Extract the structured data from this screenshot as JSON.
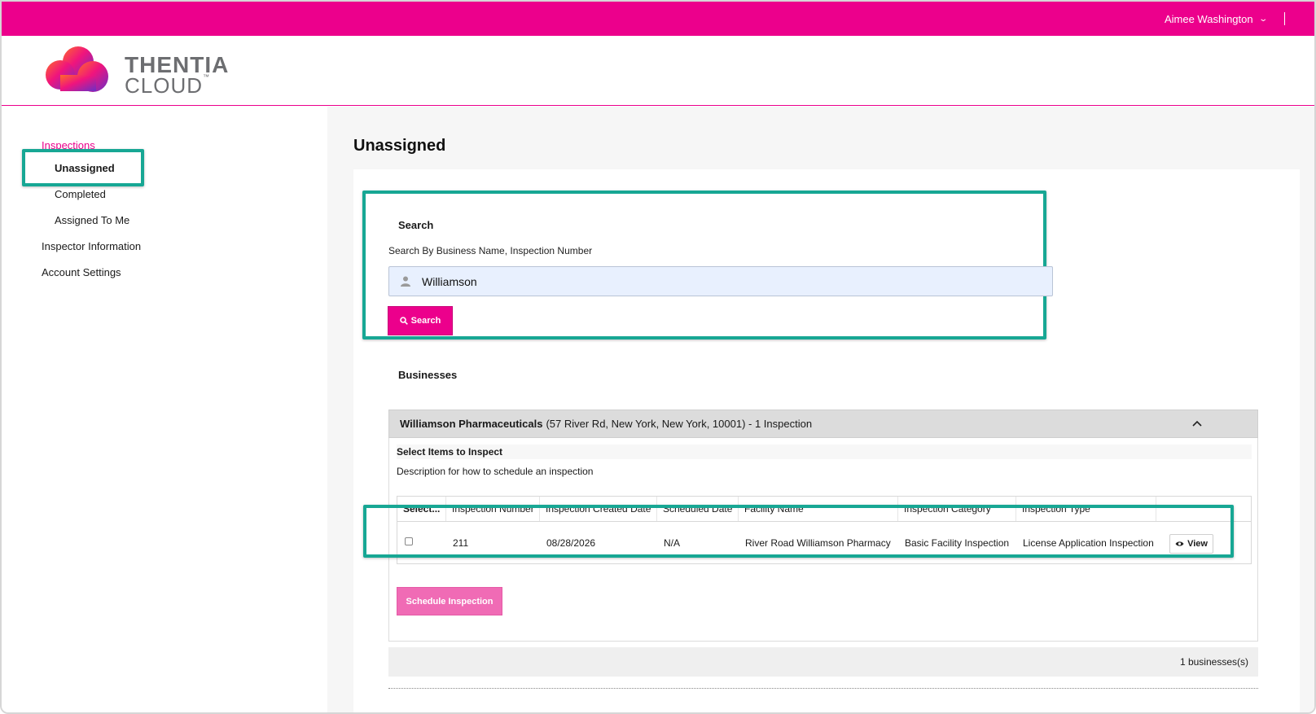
{
  "colors": {
    "brand": "#ec008c",
    "highlight": "#17a794",
    "schedule_button": "#f06bb5"
  },
  "topbar": {
    "user_name": "Aimee Washington",
    "chevron_icon": "chevron-down-icon"
  },
  "logo": {
    "line1": "THENTIA",
    "line2": "CLOUD",
    "tm": "™"
  },
  "sidebar": {
    "section": "Inspections",
    "items": [
      {
        "label": "Unassigned",
        "active": true
      },
      {
        "label": "Completed"
      },
      {
        "label": "Assigned To Me"
      },
      {
        "label": "Inspector Information"
      },
      {
        "label": "Account Settings"
      }
    ]
  },
  "main": {
    "title": "Unassigned",
    "search": {
      "title": "Search",
      "label": "Search By Business Name, Inspection Number",
      "value": "Williamson",
      "button": "Search"
    },
    "businesses": {
      "title": "Businesses",
      "business": {
        "name": "Williamson Pharmaceuticals",
        "details": "(57 River Rd, New York, New York, 10001) - 1 Inspection"
      },
      "select_title": "Select Items to Inspect",
      "select_desc": "Description for how to schedule an inspection",
      "columns": [
        "Select...",
        "Inspection Number",
        "Inspection Created Date",
        "Scheduled Date",
        "Facility Name",
        "Inspection Category",
        "Inspection Type",
        ""
      ],
      "rows": [
        {
          "inspection_number": "211",
          "created": "08/28/2026",
          "scheduled": "N/A",
          "facility": "River Road Williamson Pharmacy",
          "category": "Basic Facility Inspection",
          "type": "License Application Inspection",
          "action": "View"
        }
      ],
      "schedule_button": "Schedule Inspection",
      "count": "1 businesses(s)"
    }
  }
}
